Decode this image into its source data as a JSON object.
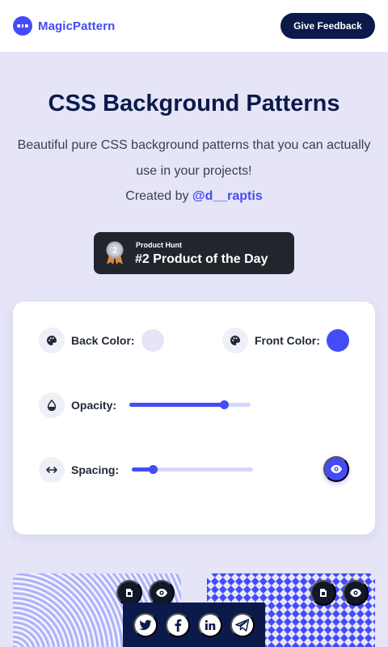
{
  "brand": {
    "name": "MagicPattern",
    "accent": "#444cf7",
    "navy": "#0b1a4a"
  },
  "header": {
    "feedback_label": "Give Feedback"
  },
  "hero": {
    "title": "CSS Background Patterns",
    "subtitle": "Beautiful pure CSS background patterns that you can actually use in your projects!",
    "credit_prefix": "Created by",
    "credit_handle": "@d__raptis"
  },
  "product_hunt": {
    "label": "Product Hunt",
    "title": "#2 Product of the Day",
    "medal_number": "2"
  },
  "controls": {
    "back_color": {
      "label": "Back Color:",
      "value": "#e5e5f7",
      "icon": "palette-icon"
    },
    "front_color": {
      "label": "Front Color:",
      "value": "#444cf7",
      "icon": "palette-icon"
    },
    "opacity": {
      "label": "Opacity:",
      "value": 0.78,
      "icon": "droplet-icon"
    },
    "spacing": {
      "label": "Spacing:",
      "value": 0.17,
      "icon": "arrows-horizontal-icon"
    },
    "preview_icon": "eye-icon"
  },
  "patterns": [
    {
      "name": "pattern-radial",
      "actions": [
        "copy-icon",
        "eye-icon"
      ]
    },
    {
      "name": "pattern-zigzag",
      "actions": [
        "copy-icon",
        "eye-icon"
      ]
    }
  ],
  "share": {
    "icons": [
      "twitter-icon",
      "facebook-icon",
      "linkedin-icon",
      "telegram-icon"
    ]
  }
}
